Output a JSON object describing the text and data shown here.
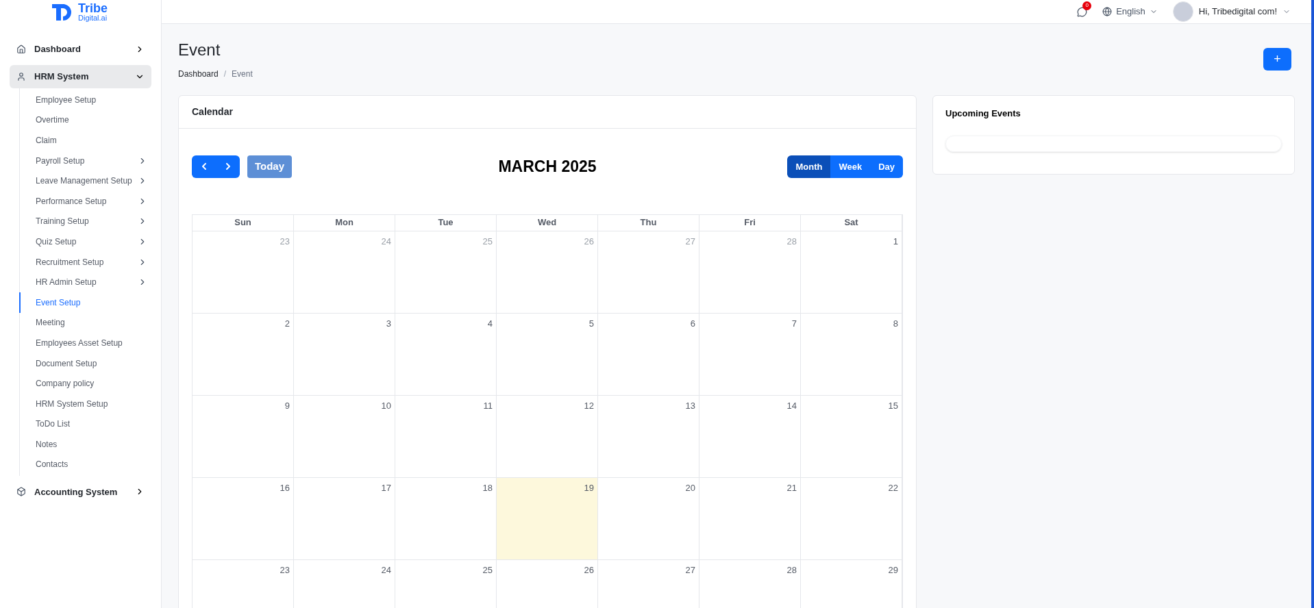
{
  "logo": {
    "name": "Tribe",
    "subname": "Digital.ai"
  },
  "sidebar": {
    "items": [
      {
        "label": "Dashboard",
        "expanded": false,
        "selected": false
      },
      {
        "label": "HRM System",
        "expanded": true,
        "selected": true,
        "children": [
          {
            "label": "Employee Setup",
            "has_submenu": false,
            "selected": false
          },
          {
            "label": "Overtime",
            "has_submenu": false,
            "selected": false
          },
          {
            "label": "Claim",
            "has_submenu": false,
            "selected": false
          },
          {
            "label": "Payroll Setup",
            "has_submenu": true,
            "selected": false
          },
          {
            "label": "Leave Management Setup",
            "has_submenu": true,
            "selected": false
          },
          {
            "label": "Performance Setup",
            "has_submenu": true,
            "selected": false
          },
          {
            "label": "Training Setup",
            "has_submenu": true,
            "selected": false
          },
          {
            "label": "Quiz Setup",
            "has_submenu": true,
            "selected": false
          },
          {
            "label": "Recruitment Setup",
            "has_submenu": true,
            "selected": false
          },
          {
            "label": "HR Admin Setup",
            "has_submenu": true,
            "selected": false
          },
          {
            "label": "Event Setup",
            "has_submenu": false,
            "selected": true
          },
          {
            "label": "Meeting",
            "has_submenu": false,
            "selected": false
          },
          {
            "label": "Employees Asset Setup",
            "has_submenu": false,
            "selected": false
          },
          {
            "label": "Document Setup",
            "has_submenu": false,
            "selected": false
          },
          {
            "label": "Company policy",
            "has_submenu": false,
            "selected": false
          },
          {
            "label": "HRM System Setup",
            "has_submenu": false,
            "selected": false
          },
          {
            "label": "ToDo List",
            "has_submenu": false,
            "selected": false
          },
          {
            "label": "Notes",
            "has_submenu": false,
            "selected": false
          },
          {
            "label": "Contacts",
            "has_submenu": false,
            "selected": false
          }
        ]
      },
      {
        "label": "Accounting System",
        "expanded": false,
        "selected": false
      }
    ]
  },
  "top_bar": {
    "message_count": "0",
    "language": "English",
    "greeting": "Hi, Tribedigital com!"
  },
  "page": {
    "title": "Event",
    "breadcrumb": [
      "Dashboard",
      "Event"
    ],
    "breadcrumb_separator": "/",
    "add_button": "+"
  },
  "calendar": {
    "title": "Calendar",
    "today_button": "Today",
    "month_title": "MARCH 2025",
    "views": [
      {
        "label": "Month",
        "selected": true
      },
      {
        "label": "Week",
        "selected": false
      },
      {
        "label": "Day",
        "selected": false
      }
    ],
    "weekdays": [
      "Sun",
      "Mon",
      "Tue",
      "Wed",
      "Thu",
      "Fri",
      "Sat"
    ],
    "weeks": [
      [
        {
          "label": "23",
          "other_month": true,
          "today": false
        },
        {
          "label": "24",
          "other_month": true,
          "today": false
        },
        {
          "label": "25",
          "other_month": true,
          "today": false
        },
        {
          "label": "26",
          "other_month": true,
          "today": false
        },
        {
          "label": "27",
          "other_month": true,
          "today": false
        },
        {
          "label": "28",
          "other_month": true,
          "today": false
        },
        {
          "label": "1",
          "other_month": false,
          "today": false
        }
      ],
      [
        {
          "label": "2",
          "other_month": false,
          "today": false
        },
        {
          "label": "3",
          "other_month": false,
          "today": false
        },
        {
          "label": "4",
          "other_month": false,
          "today": false
        },
        {
          "label": "5",
          "other_month": false,
          "today": false
        },
        {
          "label": "6",
          "other_month": false,
          "today": false
        },
        {
          "label": "7",
          "other_month": false,
          "today": false
        },
        {
          "label": "8",
          "other_month": false,
          "today": false
        }
      ],
      [
        {
          "label": "9",
          "other_month": false,
          "today": false
        },
        {
          "label": "10",
          "other_month": false,
          "today": false
        },
        {
          "label": "11",
          "other_month": false,
          "today": false
        },
        {
          "label": "12",
          "other_month": false,
          "today": false
        },
        {
          "label": "13",
          "other_month": false,
          "today": false
        },
        {
          "label": "14",
          "other_month": false,
          "today": false
        },
        {
          "label": "15",
          "other_month": false,
          "today": false
        }
      ],
      [
        {
          "label": "16",
          "other_month": false,
          "today": false
        },
        {
          "label": "17",
          "other_month": false,
          "today": false
        },
        {
          "label": "18",
          "other_month": false,
          "today": false
        },
        {
          "label": "19",
          "other_month": false,
          "today": true
        },
        {
          "label": "20",
          "other_month": false,
          "today": false
        },
        {
          "label": "21",
          "other_month": false,
          "today": false
        },
        {
          "label": "22",
          "other_month": false,
          "today": false
        }
      ],
      [
        {
          "label": "23",
          "other_month": false,
          "today": false
        },
        {
          "label": "24",
          "other_month": false,
          "today": false
        },
        {
          "label": "25",
          "other_month": false,
          "today": false
        },
        {
          "label": "26",
          "other_month": false,
          "today": false
        },
        {
          "label": "27",
          "other_month": false,
          "today": false
        },
        {
          "label": "28",
          "other_month": false,
          "today": false
        },
        {
          "label": "29",
          "other_month": false,
          "today": false
        }
      ]
    ]
  },
  "upcoming": {
    "title": "Upcoming Events"
  }
}
